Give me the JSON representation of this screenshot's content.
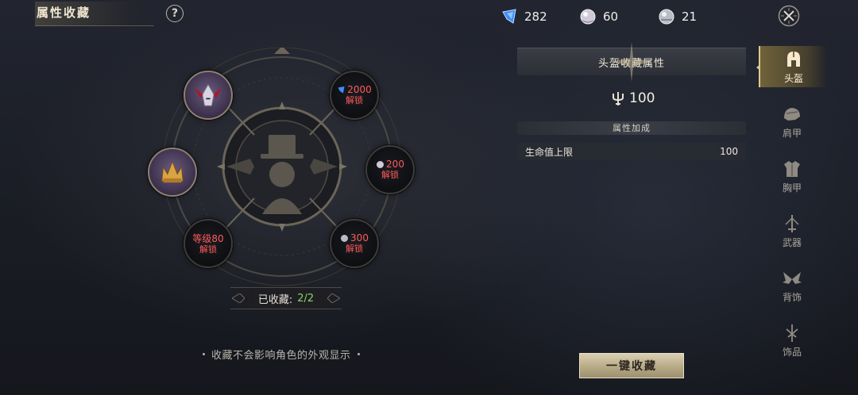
{
  "header": {
    "title": "属性收藏",
    "help_label": "?"
  },
  "currencies": [
    {
      "icon": "blue-crystal-icon",
      "value": "282"
    },
    {
      "icon": "pearl-orb-icon",
      "value": "60"
    },
    {
      "icon": "silver-orb-icon",
      "value": "21"
    }
  ],
  "ring": {
    "slots": [
      {
        "state": "collected",
        "item": "purple-winged-helmet-icon"
      },
      {
        "state": "collected",
        "item": "golden-crown-helmet-icon"
      },
      {
        "state": "locked",
        "cost_icon": "blue-crystal-icon",
        "cost": "2000",
        "unlock": "解锁"
      },
      {
        "state": "locked",
        "cost_icon": "pearl-orb-icon",
        "cost": "200",
        "unlock": "解锁"
      },
      {
        "state": "locked",
        "level_text": "等级80",
        "unlock": "解锁"
      },
      {
        "state": "locked",
        "cost_icon": "silver-orb-icon",
        "cost": "300",
        "unlock": "解锁"
      }
    ],
    "collected_label": "已收藏:",
    "collected_value": "2/2"
  },
  "note": "收藏不会影响角色的外观显示",
  "panel": {
    "title": "头盔收藏属性",
    "score_icon": "trident-icon",
    "score": "100",
    "bonus_header": "属性加成",
    "attributes": [
      {
        "name": "生命值上限",
        "value": "100"
      }
    ],
    "one_click_label": "一键收藏"
  },
  "tabs": [
    {
      "label": "头盔",
      "icon": "helmet-icon",
      "active": true
    },
    {
      "label": "肩甲",
      "icon": "shoulder-armor-icon",
      "active": false
    },
    {
      "label": "胸甲",
      "icon": "chest-armor-icon",
      "active": false
    },
    {
      "label": "武器",
      "icon": "weapon-icon",
      "active": false
    },
    {
      "label": "背饰",
      "icon": "wings-icon",
      "active": false
    },
    {
      "label": "饰品",
      "icon": "ornament-icon",
      "active": false
    }
  ],
  "colors": {
    "accent_gold": "#e0c98e",
    "locked_red": "#ff5a5a",
    "collected_green": "#8ed06a"
  }
}
